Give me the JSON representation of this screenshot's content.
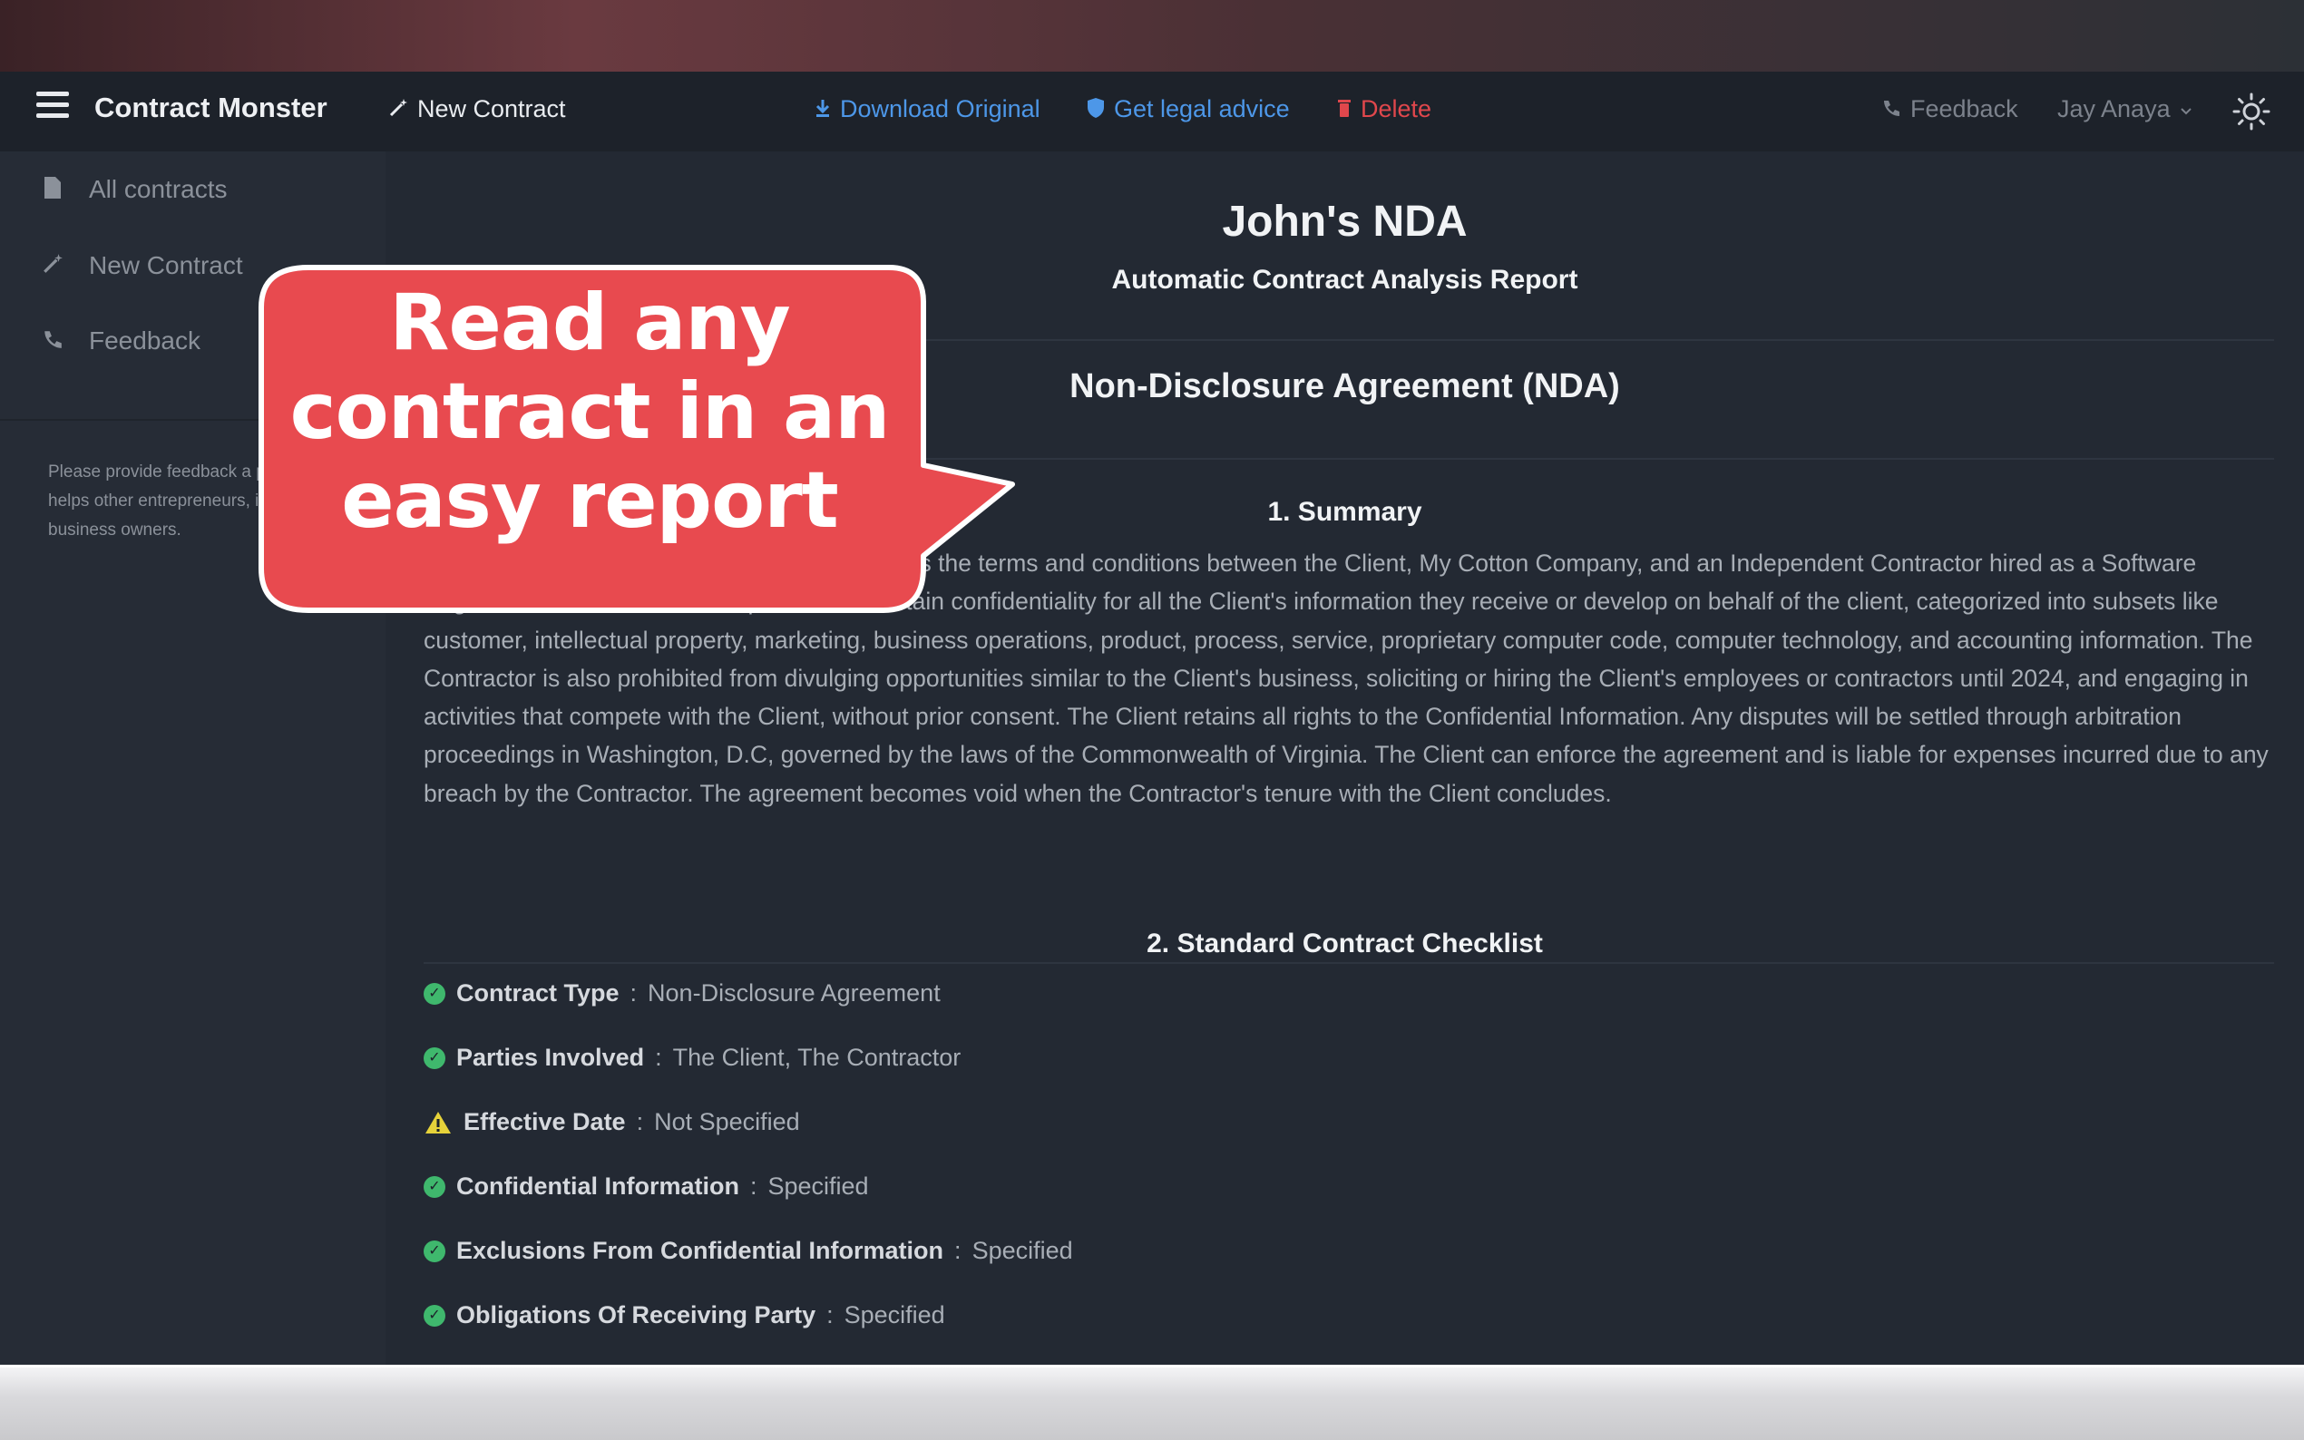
{
  "topbar": {
    "brand": "Contract Monster",
    "new_contract": "New Contract",
    "download": "Download Original",
    "legal_advice": "Get legal advice",
    "delete": "Delete",
    "feedback": "Feedback",
    "user": "Jay Anaya"
  },
  "sidebar": {
    "items": [
      {
        "label": "All contracts",
        "icon": "document-icon"
      },
      {
        "label": "New Contract",
        "icon": "magic-wand-icon"
      },
      {
        "label": "Feedback",
        "icon": "phone-icon"
      }
    ],
    "note": "Please provide feedback a product that helps other entrepreneurs, intrapreneurs business owners."
  },
  "report": {
    "title": "John's NDA",
    "subtitle": "Automatic Contract Analysis Report",
    "agreement_type": "Non-Disclosure Agreement (NDA)",
    "summary_heading": "1. Summary",
    "summary_text": "The non-disclosure agreement contract outlines the terms and conditions between the Client, My Cotton Company, and an Independent Contractor hired as a Software Engineer. The Contractor is expected to maintain confidentiality for all the Client's information they receive or develop on behalf of the client, categorized into subsets like customer, intellectual property, marketing, business operations, product, process, service, proprietary computer code, computer technology, and accounting information. The Contractor is also prohibited from divulging opportunities similar to the Client's business, soliciting or hiring the Client's employees or contractors until 2024, and engaging in activities that compete with the Client, without prior consent. The Client retains all rights to the Confidential Information. Any disputes will be settled through arbitration proceedings in Washington, D.C, governed by the laws of the Commonwealth of Virginia. The Client can enforce the agreement and is liable for expenses incurred due to any breach by the Contractor. The agreement becomes void when the Contractor's tenure with the Client concludes.",
    "checklist_heading": "2. Standard Contract Checklist",
    "checklist": [
      {
        "label": "Contract Type",
        "value": "Non-Disclosure Agreement",
        "status": "ok"
      },
      {
        "label": "Parties Involved",
        "value": "The Client, The Contractor",
        "status": "ok"
      },
      {
        "label": "Effective Date",
        "value": "Not Specified",
        "status": "warning"
      },
      {
        "label": "Confidential Information",
        "value": "Specified",
        "status": "ok"
      },
      {
        "label": "Exclusions From Confidential Information",
        "value": "Specified",
        "status": "ok"
      },
      {
        "label": "Obligations Of Receiving Party",
        "value": "Specified",
        "status": "ok"
      }
    ]
  },
  "callout": {
    "lines": [
      "Read any",
      "contract in an",
      "easy report"
    ],
    "color": "#e84a4f"
  },
  "colors": {
    "link_blue": "#4d97e8",
    "delete_red": "#e0474c",
    "ok_green": "#3fb86d",
    "warn_yellow": "#e6d23a"
  }
}
